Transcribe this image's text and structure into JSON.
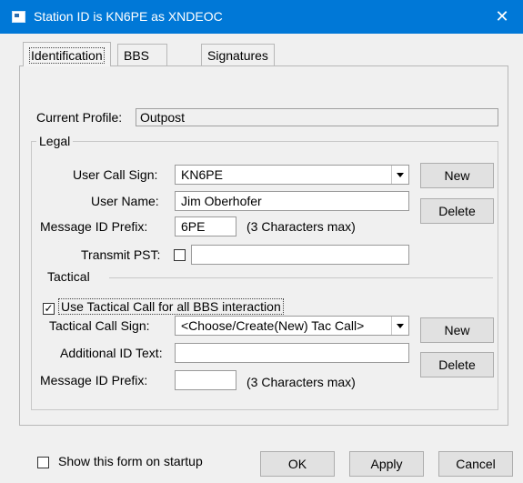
{
  "window": {
    "title": "Station ID is KN6PE as XNDEOC",
    "close_glyph": "✕"
  },
  "tabs": [
    {
      "label": "Identification"
    },
    {
      "label": "BBS Logins"
    },
    {
      "label": "Signatures"
    }
  ],
  "profile": {
    "label": "Current Profile:",
    "value": "Outpost"
  },
  "legal": {
    "group_label": "Legal",
    "user_call_sign_label": "User Call Sign:",
    "user_call_sign_value": "KN6PE",
    "user_name_label": "User Name:",
    "user_name_value": "Jim Oberhofer",
    "msg_id_prefix_label": "Message ID Prefix:",
    "msg_id_prefix_value": "6PE",
    "msg_id_hint": "(3 Characters max)",
    "transmit_pst_label": "Transmit PST:",
    "transmit_pst_value": "",
    "new_label": "New",
    "delete_label": "Delete"
  },
  "tactical": {
    "group_label": "Tactical",
    "use_tactical_label": "Use Tactical Call for all BBS interaction",
    "use_tactical_checked": "✓",
    "tac_call_sign_label": "Tactical Call Sign:",
    "tac_call_sign_value": "<Choose/Create(New) Tac Call>",
    "additional_id_label": "Additional ID Text:",
    "additional_id_value": "",
    "msg_id_prefix_label": "Message ID Prefix:",
    "msg_id_prefix_value": "",
    "msg_id_hint": "(3 Characters max)",
    "new_label": "New",
    "delete_label": "Delete"
  },
  "footer": {
    "show_on_startup_label": "Show this form on startup",
    "ok_label": "OK",
    "apply_label": "Apply",
    "cancel_label": "Cancel"
  },
  "colors": {
    "titlebar": "#0078d7",
    "dialog_bg": "#f0f0f0"
  }
}
